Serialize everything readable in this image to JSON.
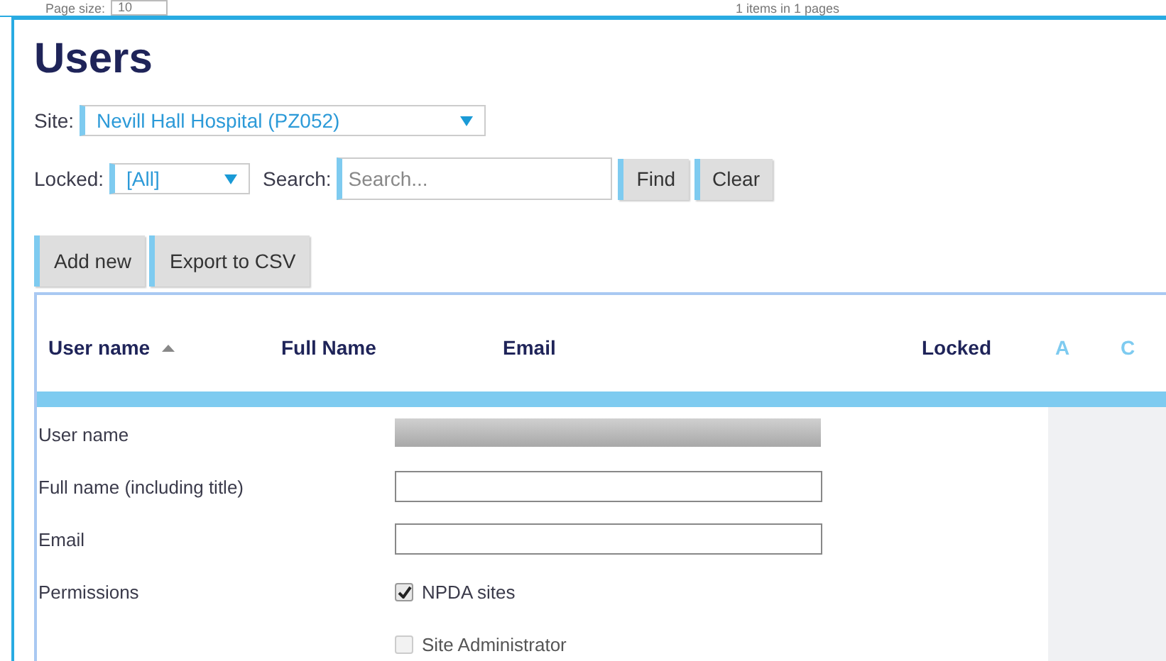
{
  "background_page": {
    "page_size_label": "Page size:",
    "page_size_value": "10",
    "items_summary": "1 items in 1 pages"
  },
  "title": "Users",
  "site_filter": {
    "label": "Site:",
    "value": "Nevill Hall Hospital (PZ052)"
  },
  "locked_filter": {
    "label": "Locked:",
    "value": "[All]"
  },
  "search": {
    "label": "Search:",
    "placeholder": "Search..."
  },
  "search_buttons": [
    "Find",
    "Clear"
  ],
  "action_buttons": [
    "Add new",
    "Export to CSV"
  ],
  "table": {
    "columns": [
      {
        "label": "User name",
        "sorted": true,
        "kind": "header"
      },
      {
        "label": "Full Name",
        "sorted": false,
        "kind": "header"
      },
      {
        "label": "Email",
        "sorted": false,
        "kind": "header"
      },
      {
        "label": "Locked",
        "sorted": false,
        "kind": "header"
      },
      {
        "label": "A",
        "sorted": false,
        "kind": "link"
      },
      {
        "label": "C",
        "sorted": false,
        "kind": "link"
      }
    ]
  },
  "form": {
    "rows": [
      {
        "label": "User name",
        "kind": "disabled_input"
      },
      {
        "label": "Full name (including title)",
        "kind": "input"
      },
      {
        "label": "Email",
        "kind": "input"
      },
      {
        "label": "Permissions",
        "kind": "checkbox",
        "option": "NPDA sites",
        "checked": true,
        "disabled": false
      },
      {
        "kind": "checkbox",
        "option": "Site Administrator",
        "checked": false,
        "disabled": true
      }
    ]
  }
}
